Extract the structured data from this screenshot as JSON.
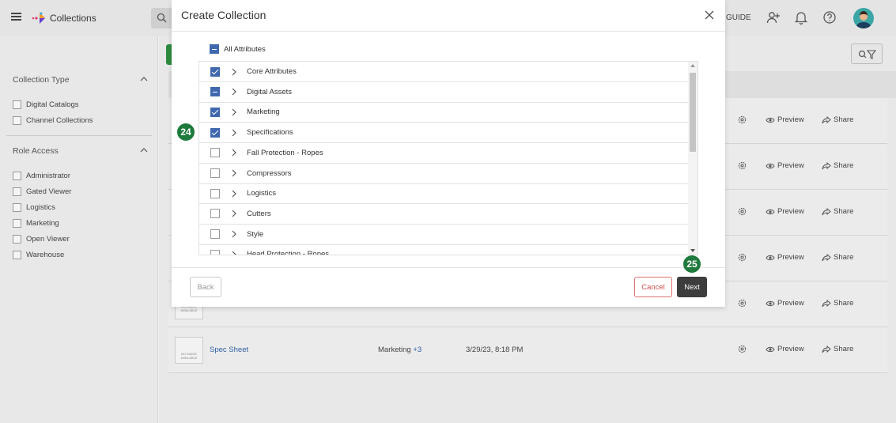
{
  "app": {
    "title": "Collections",
    "guide_label": "GUIDE"
  },
  "sidebar": {
    "sections": [
      {
        "title": "Collection Type",
        "items": [
          "Digital Catalogs",
          "Channel Collections"
        ]
      },
      {
        "title": "Role Access",
        "items": [
          "Administrator",
          "Gated Viewer",
          "Logistics",
          "Marketing",
          "Open Viewer",
          "Warehouse"
        ]
      }
    ]
  },
  "table": {
    "preview_label": "Preview",
    "share_label": "Share",
    "no_image_label": "NO IMAGE AVAILABLE",
    "last_row": {
      "name": "Spec Sheet",
      "role": "Marketing",
      "role_more": "+3",
      "date": "3/29/23, 8:18 PM"
    }
  },
  "modal": {
    "title": "Create Collection",
    "all_attributes_label": "All Attributes",
    "all_attributes_state": "partial",
    "items": [
      {
        "label": "Core Attributes",
        "state": "checked"
      },
      {
        "label": "Digital Assets",
        "state": "partial"
      },
      {
        "label": "Marketing",
        "state": "checked"
      },
      {
        "label": "Specifications",
        "state": "checked"
      },
      {
        "label": "Fall Protection - Ropes",
        "state": "unchecked"
      },
      {
        "label": "Compressors",
        "state": "unchecked"
      },
      {
        "label": "Logistics",
        "state": "unchecked"
      },
      {
        "label": "Cutters",
        "state": "unchecked"
      },
      {
        "label": "Style",
        "state": "unchecked"
      },
      {
        "label": "Head Protection - Ropes",
        "state": "unchecked"
      }
    ],
    "back_label": "Back",
    "cancel_label": "Cancel",
    "next_label": "Next"
  },
  "steps": {
    "step_a": "24",
    "step_b": "25"
  },
  "colors": {
    "accent": "#3f68ae",
    "step_badge": "#1f7a3d",
    "next_button": "#3d3d3d",
    "cancel": "#d05050"
  }
}
